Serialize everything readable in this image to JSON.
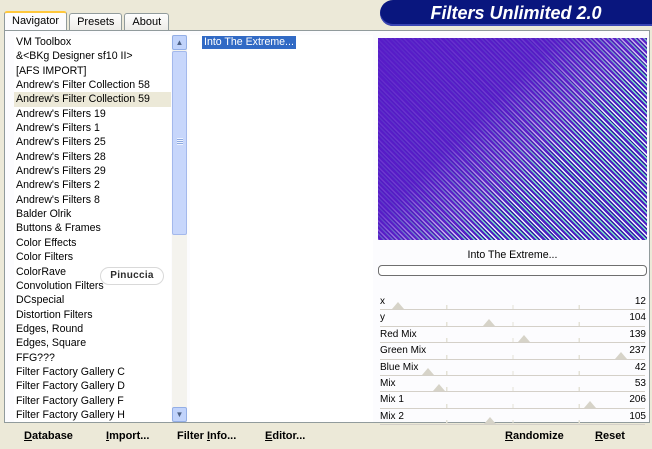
{
  "tabs": [
    {
      "label": "Navigator",
      "active": true
    },
    {
      "label": "Presets",
      "active": false
    },
    {
      "label": "About",
      "active": false
    }
  ],
  "banner": {
    "title": "Filters Unlimited 2.0"
  },
  "categories": [
    "VM Toolbox",
    "&<BKg Designer sf10 II>",
    "[AFS IMPORT]",
    "Andrew's Filter Collection 58",
    "Andrew's Filter Collection 59",
    "Andrew's Filters 19",
    "Andrew's Filters 1",
    "Andrew's Filters 25",
    "Andrew's Filters 28",
    "Andrew's Filters 29",
    "Andrew's Filters 2",
    "Andrew's Filters 8",
    "Balder Olrik",
    "Buttons & Frames",
    "Color Effects",
    "Color Filters",
    "ColorRave",
    "Convolution Filters",
    "DCspecial",
    "Distortion Filters",
    "Edges, Round",
    "Edges, Square",
    "FFG???",
    "Filter Factory Gallery C",
    "Filter Factory Gallery D",
    "Filter Factory Gallery F",
    "Filter Factory Gallery H"
  ],
  "selected_category": "Andrew's Filter Collection 59",
  "scrollbar": {
    "up_arrow": "▲",
    "down_arrow": "▼"
  },
  "filters": [
    "Into The Extreme..."
  ],
  "preview": {
    "title": "Into The Extreme..."
  },
  "parameters": [
    {
      "label": "x",
      "value": 12,
      "max": 255
    },
    {
      "label": "y",
      "value": 104,
      "max": 255
    },
    {
      "label": "Red Mix",
      "value": 139,
      "max": 255
    },
    {
      "label": "Green Mix",
      "value": 237,
      "max": 255
    },
    {
      "label": "Blue Mix",
      "value": 42,
      "max": 255
    },
    {
      "label": "Mix",
      "value": 53,
      "max": 255
    },
    {
      "label": "Mix 1",
      "value": 206,
      "max": 255
    },
    {
      "label": "Mix 2",
      "value": 105,
      "max": 255
    }
  ],
  "buttons": {
    "database": {
      "key": "D",
      "rest": "atabase"
    },
    "import": {
      "key": "I",
      "rest": "mport..."
    },
    "filter_info": {
      "pre": "Filter ",
      "key": "I",
      "rest": "nfo..."
    },
    "editor": {
      "key": "E",
      "rest": "ditor..."
    },
    "randomize": {
      "key": "R",
      "rest": "andomize"
    },
    "reset": {
      "key": "R",
      "rest": "eset"
    }
  },
  "watermark": "Pinuccia",
  "colors": {
    "banner": "#09167e",
    "selection": "#316ac5",
    "active_tab_accent": "#ffc83c"
  }
}
